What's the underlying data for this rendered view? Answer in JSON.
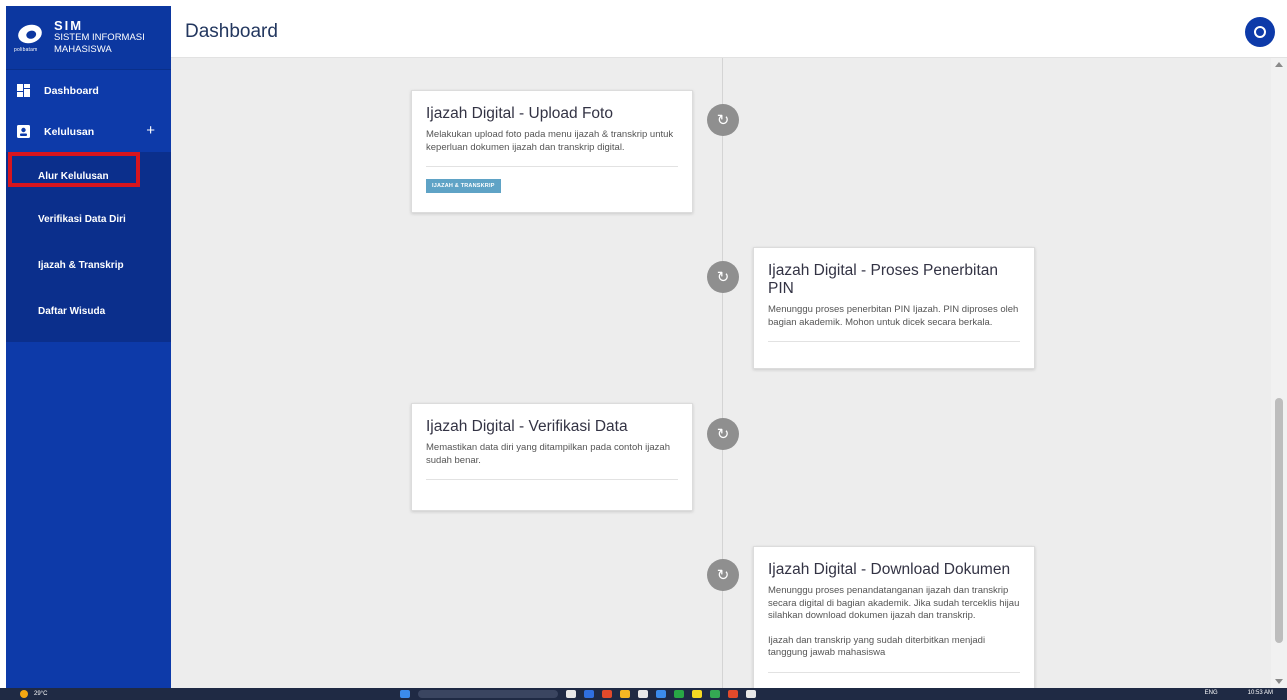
{
  "brand": {
    "logo_caption": "polibatam",
    "line1": "SIM",
    "line2": "SISTEM INFORMASI",
    "line3": "MAHASISWA"
  },
  "sidebar": {
    "items": [
      {
        "label": "Dashboard",
        "icon": "dashboard-icon"
      },
      {
        "label": "Kelulusan",
        "icon": "graduation-icon",
        "expand": "+"
      }
    ],
    "submenu": [
      {
        "label": "Alur Kelulusan",
        "active": true
      },
      {
        "label": "Verifikasi Data Diri"
      },
      {
        "label": "Ijazah & Transkrip"
      },
      {
        "label": "Daftar Wisuda"
      }
    ]
  },
  "header": {
    "title": "Dashboard",
    "avatar_icon": "user-icon"
  },
  "timeline": [
    {
      "title": "Ijazah Digital - Upload Foto",
      "desc": "Melakukan upload foto pada menu ijazah & transkrip untuk keperluan dokumen ijazah dan transkrip digital.",
      "tag": "IJAZAH & TRANSKRIP",
      "side": "left",
      "node_icon": "refresh-icon"
    },
    {
      "title": "Ijazah Digital - Proses Penerbitan PIN",
      "desc": "Menunggu proses penerbitan PIN Ijazah. PIN diproses oleh bagian akademik. Mohon untuk dicek secara berkala.",
      "side": "right",
      "node_icon": "refresh-icon"
    },
    {
      "title": "Ijazah Digital - Verifikasi Data",
      "desc": "Memastikan data diri yang ditampilkan pada contoh ijazah sudah benar.",
      "side": "left",
      "node_icon": "refresh-icon"
    },
    {
      "title": "Ijazah Digital - Download Dokumen",
      "desc": "Menunggu proses penandatanganan ijazah dan transkrip secara digital di bagian akademik. Jika sudah terceklis hijau silahkan download dokumen ijazah dan transkrip.",
      "desc2": "Ijazah dan transkrip yang sudah diterbitkan menjadi tanggung jawab mahasiswa",
      "side": "right",
      "node_icon": "refresh-icon"
    }
  ],
  "taskbar": {
    "weather": "29°C",
    "lang": "ENG",
    "time": "10:53 AM"
  },
  "colors": {
    "sidebar": "#0d3aa9",
    "highlight": "#d7151e",
    "tag": "#5fa3c6",
    "node": "#8f8f8f"
  }
}
